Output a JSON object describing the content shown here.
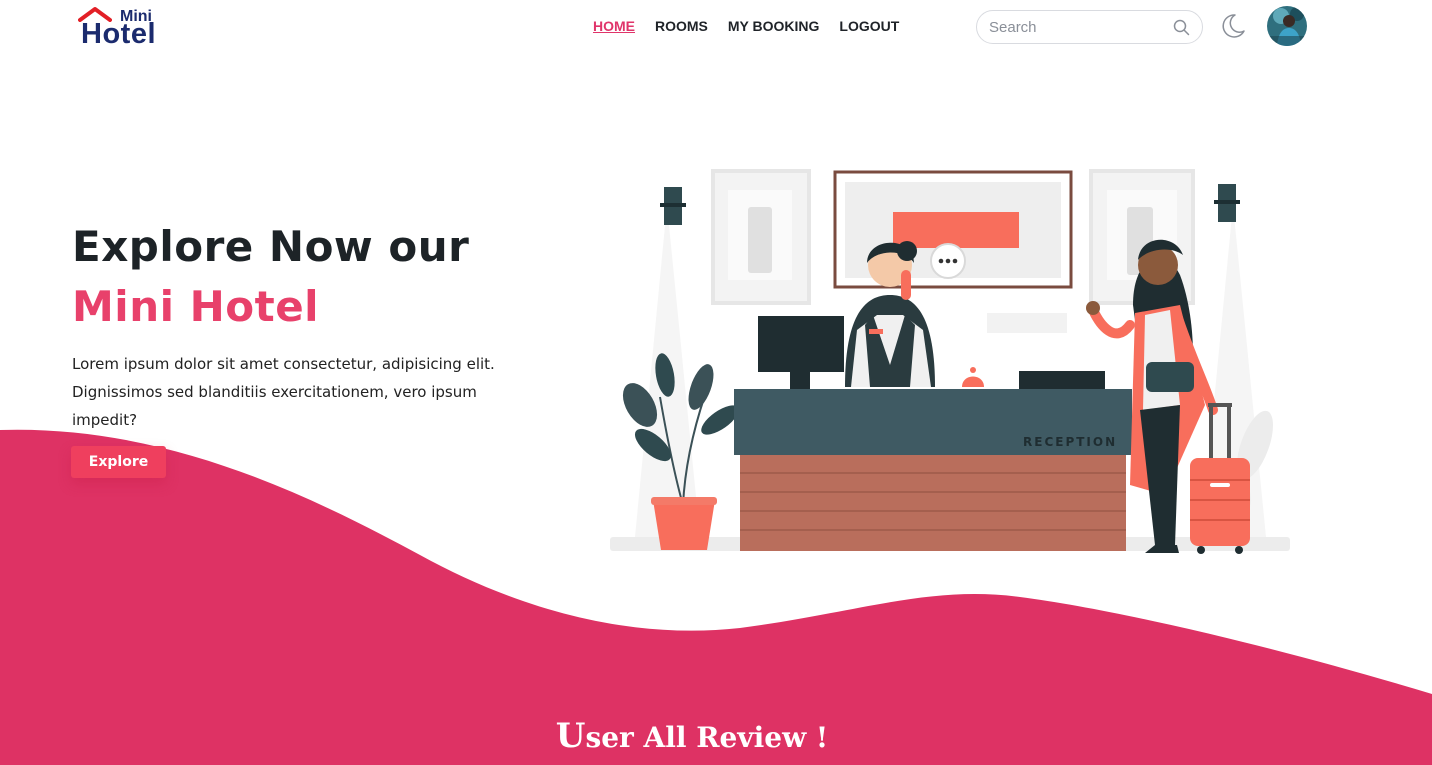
{
  "brand": {
    "small": "Mini",
    "large": "Hotel"
  },
  "nav": [
    {
      "label": "HOME",
      "active": true
    },
    {
      "label": "ROOMS",
      "active": false
    },
    {
      "label": "MY BOOKING",
      "active": false
    },
    {
      "label": "LOGOUT",
      "active": false
    }
  ],
  "search": {
    "placeholder": "Search",
    "value": ""
  },
  "icons": {
    "search": "search-icon",
    "theme": "moon-icon",
    "avatar": "user-avatar"
  },
  "hero": {
    "title_line1": "Explore Now our",
    "title_line2": "Mini Hotel",
    "description": "Lorem ipsum dolor sit amet consectetur, adipisicing elit. Dignissimos sed blanditiis exercitationem, vero ipsum impedit?",
    "cta": "Explore",
    "illustration_sign": "RECEPTION"
  },
  "reviews": {
    "title_first": "U",
    "title_rest": "ser All Review !"
  },
  "colors": {
    "accent": "#e0346a",
    "brand": "#1b2b6e",
    "button": "#ef3f5e",
    "desk": "#3f5a63",
    "coral": "#f86e5c"
  }
}
